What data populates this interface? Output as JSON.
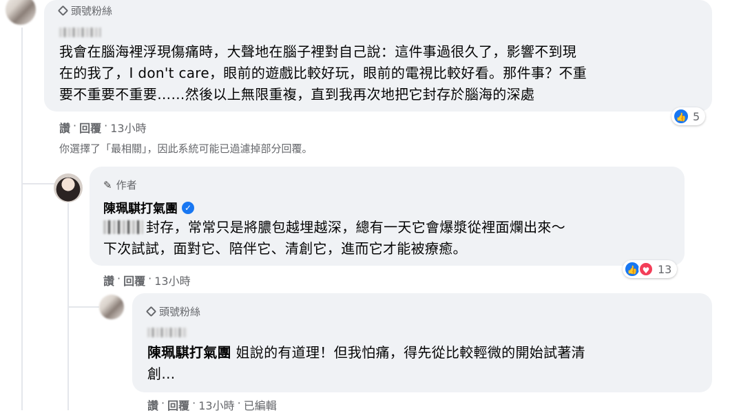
{
  "comment1": {
    "badge": "頭號粉絲",
    "text_line1": "我會在腦海裡浮現傷痛時，大聲地在腦子裡對自己說：這件事過很久了，影響不到現",
    "text_line2": "在的我了，I don't care，眼前的遊戲比較好玩，眼前的電視比較好看。那件事？不重",
    "text_line3": "要不重要不重要……然後以上無限重複，直到我再次地把它封存於腦海的深處",
    "reaction_count": "5",
    "actions": {
      "like": "讚",
      "reply": "回覆",
      "time": "13小時"
    }
  },
  "notice": "你選擇了「最相關」，因此系統可能已過濾掉部分回覆。",
  "comment2": {
    "badge": "作者",
    "author": "陳珮騏打氣團",
    "text_line1": "封存，常常只是將膿包越埋越深，總有一天它會爆漿從裡面爛出來～",
    "text_line2": "下次試試，面對它、陪伴它、清創它，進而它才能被療癒。",
    "reaction_count": "13",
    "actions": {
      "like": "讚",
      "reply": "回覆",
      "time": "13小時"
    }
  },
  "comment3": {
    "badge": "頭號粉絲",
    "mention": "陳珮騏打氣團",
    "text_line1": " 姐說的有道理！但我怕痛，得先從比較輕微的開始試著清",
    "text_line2": "創…",
    "actions": {
      "like": "讚",
      "reply": "回覆",
      "time": "13小時",
      "edited": "已編輯"
    }
  },
  "colors": {
    "bubble": "#f0f2f5",
    "like": "#1877f2",
    "love": "#f33e58",
    "meta": "#65676b"
  }
}
